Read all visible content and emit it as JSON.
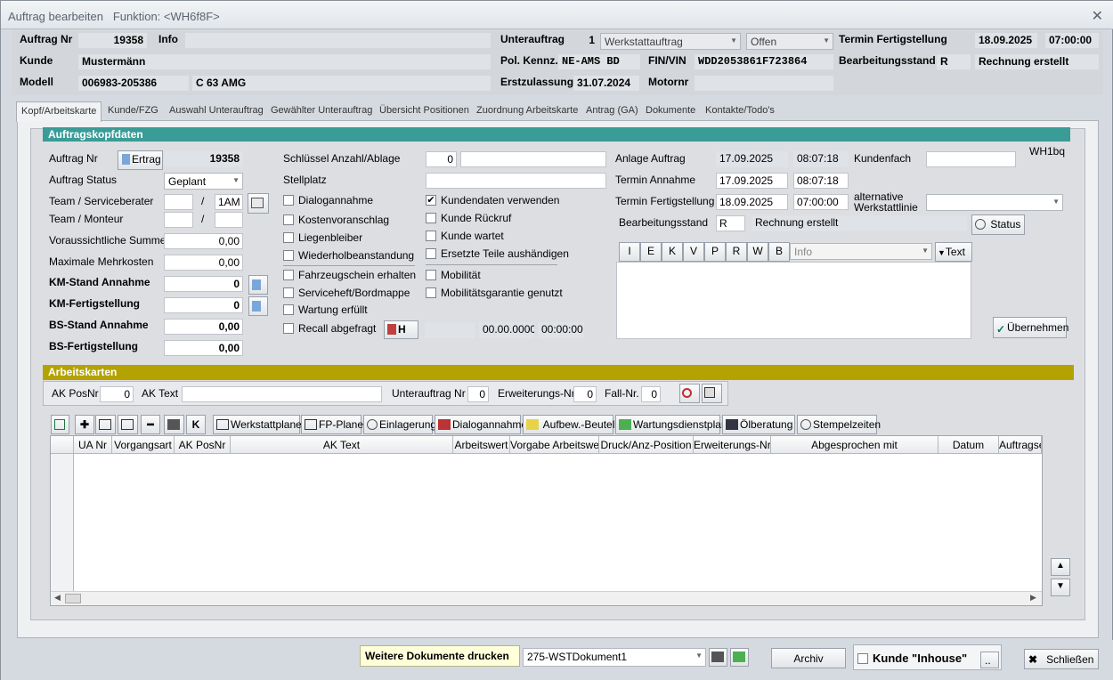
{
  "window": {
    "title": "Auftrag bearbeiten",
    "function_label": "Funktion:",
    "function_value": "<WH6f8F>"
  },
  "header": {
    "auftrag_nr_label": "Auftrag Nr",
    "auftrag_nr": "19358",
    "info_label": "Info",
    "unterauftrag_label": "Unterauftrag",
    "unterauftrag_nr": "1",
    "unterauftrag_typ": "Werkstattauftrag",
    "status": "Offen",
    "termin_fert_label": "Termin Fertigstellung",
    "termin_fert_date": "18.09.2025",
    "termin_fert_time": "07:00:00",
    "kunde_label": "Kunde",
    "kunde": "Mustermänn",
    "pol_label": "Pol. Kennz.",
    "pol": "NE-AMS BD",
    "fin_label": "FIN/VIN",
    "fin": "WDD2053861F723864",
    "bearb_label": "Bearbeitungsstand",
    "bearb_code": "R",
    "bearb_text": "Rechnung erstellt",
    "modell_label": "Modell",
    "modell_nr": "006983-205386",
    "modell_name": "C 63 AMG",
    "erstzul_label": "Erstzulassung",
    "erstzul": "31.07.2024",
    "motornr_label": "Motornr"
  },
  "tabs": [
    "Kopf/Arbeitskarte",
    "Kunde/FZG",
    "Auswahl Unterauftrag",
    "Gewählter Unterauftrag",
    "Übersicht Positionen",
    "Zuordnung Arbeitskarte",
    "Antrag (GA)",
    "Dokumente",
    "Kontakte/Todo's"
  ],
  "kopf": {
    "section_title": "Auftragskopfdaten",
    "auftrag_nr_label": "Auftrag Nr",
    "ertrag_btn": "Ertrag",
    "auftrag_nr": "19358",
    "status_label": "Auftrag Status",
    "status_value": "Geplant",
    "team_service_label": "Team / Serviceberater",
    "team_service_value": "1AM",
    "slash": "/",
    "team_monteur_label": "Team / Monteur",
    "vor_summe_label": "Voraussichtliche Summe",
    "vor_summe": "0,00",
    "max_mehr_label": "Maximale Mehrkosten",
    "max_mehr": "0,00",
    "km_ann_label": "KM-Stand Annahme",
    "km_ann": "0",
    "km_fert_label": "KM-Fertigstellung",
    "km_fert": "0",
    "bs_ann_label": "BS-Stand Annahme",
    "bs_ann": "0,00",
    "bs_fert_label": "BS-Fertigstellung",
    "bs_fert": "0,00",
    "schluessel_label": "Schlüssel Anzahl/Ablage",
    "schluessel": "0",
    "stellplatz_label": "Stellplatz",
    "checks_left": [
      {
        "label": "Dialogannahme",
        "checked": false
      },
      {
        "label": "Kostenvoranschlag",
        "checked": false
      },
      {
        "label": "Liegenbleiber",
        "checked": false
      },
      {
        "label": "Wiederholbeanstandung",
        "checked": false
      },
      {
        "label": "Fahrzeugschein  erhalten",
        "checked": false
      },
      {
        "label": "Serviceheft/Bordmappe",
        "checked": false
      },
      {
        "label": "Wartung erfüllt",
        "checked": false
      },
      {
        "label": "Recall abgefragt",
        "checked": false
      }
    ],
    "checks_right": [
      {
        "label": "Kundendaten verwenden",
        "checked": true
      },
      {
        "label": "Kunde Rückruf",
        "checked": false
      },
      {
        "label": "Kunde wartet",
        "checked": false
      },
      {
        "label": "Ersetzte Teile aushändigen",
        "checked": false
      },
      {
        "label": "Mobilität",
        "checked": false
      },
      {
        "label": "Mobilitätsgarantie genutzt",
        "checked": false
      }
    ],
    "recall_h": "H",
    "recall_date": "00.00.0000",
    "recall_time": "00:00:00",
    "anlage_label": "Anlage Auftrag",
    "anlage_date": "17.09.2025",
    "anlage_time": "08:07:18",
    "termin_ann_label": "Termin Annahme",
    "termin_ann_date": "17.09.2025",
    "termin_ann_time": "08:07:18",
    "termin_fert_label": "Termin Fertigstellung",
    "termin_fert_date": "18.09.2025",
    "termin_fert_time": "07:00:00",
    "bearb_label": "Bearbeitungsstand",
    "bearb_code": "R",
    "bearb_text": "Rechnung erstellt",
    "status_btn": "Status",
    "kundenfach_label": "Kundenfach",
    "wh_code": "WH1bq",
    "alt_linie_label": "alternative Werkstattlinie",
    "text_tools": [
      "I",
      "E",
      "K",
      "V",
      "P",
      "R",
      "W",
      "B"
    ],
    "info_placeholder": "Info",
    "text_btn": "Text",
    "uebernehmen_btn": "Übernehmen"
  },
  "arbeitskarten": {
    "section_title": "Arbeitskarten",
    "ak_posnr_label": "AK PosNr",
    "ak_posnr": "0",
    "ak_text_label": "AK Text",
    "unterauftrag_label": "Unterauftrag Nr",
    "unterauftrag": "0",
    "erweiterung_label": "Erweiterungs-Nr",
    "erweiterung": "0",
    "fall_label": "Fall-Nr.",
    "fall": "0",
    "toolbar": [
      "Werkstattplaner",
      "FP-Planer",
      "Einlagerung",
      "Dialogannahme",
      "Aufbew.-Beutel",
      "Wartungsdienstplan",
      "Ölberatung",
      "Stempelzeiten"
    ],
    "columns": [
      "UA Nr",
      "Vorgangsart",
      "AK PosNr",
      "AK Text",
      "Arbeitswert",
      "Vorgabe Arbeitswert",
      "Druck/Anz-Position",
      "Erweiterungs-Nr",
      "Abgesprochen mit",
      "Datum",
      "Auftragse"
    ]
  },
  "footer": {
    "weitere_label": "Weitere Dokumente drucken",
    "dokument": "275-WSTDokument1",
    "archiv_btn": "Archiv",
    "inhouse_label": "Kunde \"Inhouse\"",
    "dots": "..",
    "schliessen_btn": "Schließen"
  }
}
